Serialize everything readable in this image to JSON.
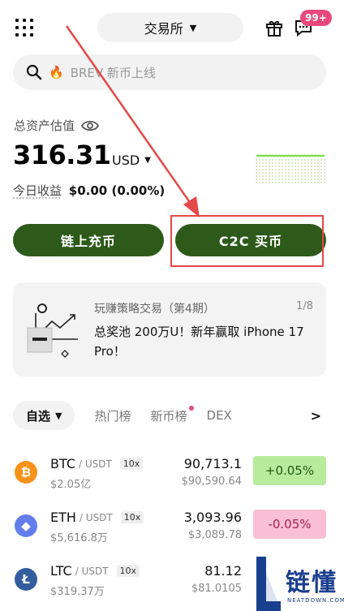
{
  "header": {
    "segment_label": "交易所",
    "notification_badge": "99+"
  },
  "search": {
    "placeholder": "BREV 新币上线"
  },
  "assets": {
    "label": "总资产估值",
    "value": "316.31",
    "currency": "USD",
    "today_label": "今日收益",
    "today_value": "$0.00 (0.00%)"
  },
  "actions": {
    "deposit_label": "链上充币",
    "c2c_label": "C2C 买币"
  },
  "promo": {
    "title": "玩赚策略交易（第4期）",
    "page": "1/8",
    "text": "总奖池 200万U！新年赢取 iPhone 17 Pro！"
  },
  "tabs": {
    "active": "自选",
    "items": [
      "热门榜",
      "新币榜",
      "DEX"
    ]
  },
  "market": {
    "rows": [
      {
        "symbol": "BTC",
        "pair": "/ USDT",
        "leverage": "10x",
        "volume": "$2.05亿",
        "price": "90,713.1",
        "fiat": "$90,590.64",
        "change": "+0.05%",
        "direction": "up",
        "icon": "bitcoin-icon",
        "color": "#f7931a"
      },
      {
        "symbol": "ETH",
        "pair": "/ USDT",
        "leverage": "10x",
        "volume": "$5,616.8万",
        "price": "3,093.96",
        "fiat": "$3,089.78",
        "change": "-0.05%",
        "direction": "down",
        "icon": "ethereum-icon",
        "color": "#627eea"
      },
      {
        "symbol": "LTC",
        "pair": "/ USDT",
        "leverage": "10x",
        "volume": "$319.37万",
        "price": "81.12",
        "fiat": "$81.0105",
        "change": "",
        "direction": "none",
        "icon": "litecoin-icon",
        "color": "#345d9d"
      }
    ]
  },
  "watermark": {
    "text": "链懂",
    "sub": "NEATDOWN.COM"
  },
  "colors": {
    "primary_button": "#2d5a1a",
    "up": "#b9eb9d",
    "down": "#f9bfd4",
    "annotation": "#e54848",
    "badge": "#e8487b"
  }
}
